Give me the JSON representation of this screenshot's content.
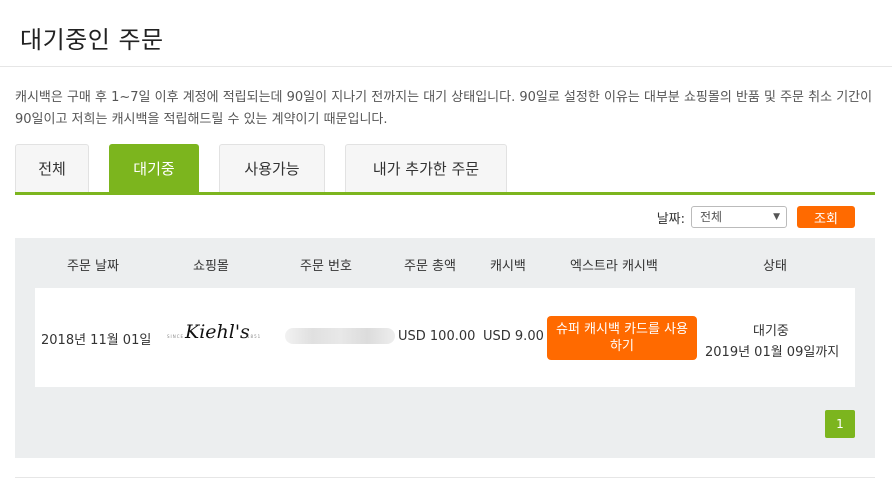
{
  "header": {
    "title": "대기중인 주문"
  },
  "notice": "캐시백은 구매 후 1~7일 이후 계정에 적립되는데 90일이 지나기 전까지는 대기 상태입니다. 90일로 설정한 이유는 대부분 쇼핑몰의 반품 및 주문 취소 기간이 90일이고 저희는 캐시백을 적립해드릴 수 있는 계약이기 때문입니다.",
  "tabs": [
    {
      "label": "전체",
      "active": false
    },
    {
      "label": "대기중",
      "active": true
    },
    {
      "label": "사용가능",
      "active": false
    },
    {
      "label": "내가 추가한 주문",
      "active": false
    }
  ],
  "filter": {
    "label": "날짜:",
    "selected": "전체",
    "search_label": "조회"
  },
  "table": {
    "headers": [
      "주문 날짜",
      "쇼핑몰",
      "주문 번호",
      "주문 총액",
      "캐시백",
      "엑스트라 캐시백",
      "상태"
    ],
    "rows": [
      {
        "date": "2018년 11월 01일",
        "store_logo_text": "Kiehl's",
        "store_logo_left": "SINCE",
        "store_logo_right": "1851",
        "order_total": "USD 100.00",
        "cashback": "USD 9.00",
        "extra_button": "슈퍼 캐시백 카드를 사용하기",
        "status": "대기중",
        "status_until": "2019년 01월 09일까지"
      }
    ]
  },
  "pagination": {
    "current": "1"
  },
  "colors": {
    "accent_green": "#7cb51e",
    "accent_orange": "#ff6a00",
    "panel_bg": "#eceeef"
  }
}
